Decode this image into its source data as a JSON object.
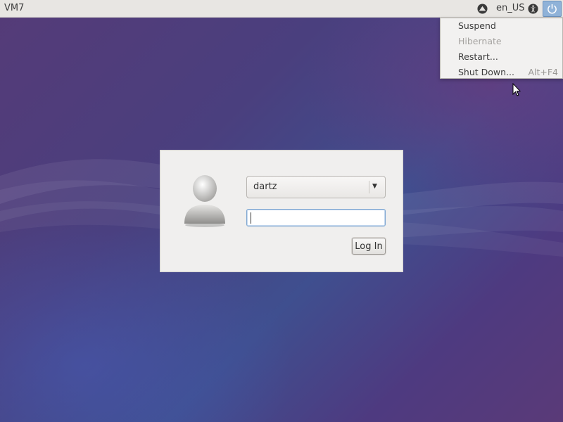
{
  "top_panel": {
    "host_name": "VM7",
    "language": "en_US",
    "icons": {
      "network": "network-icon",
      "accessibility": "accessibility-icon",
      "power": "power-icon"
    }
  },
  "power_menu": {
    "items": [
      {
        "label": "Suspend",
        "enabled": true,
        "accel": ""
      },
      {
        "label": "Hibernate",
        "enabled": false,
        "accel": ""
      },
      {
        "label": "Restart...",
        "enabled": true,
        "accel": ""
      },
      {
        "label": "Shut Down...",
        "enabled": true,
        "accel": "Alt+F4"
      }
    ]
  },
  "login": {
    "selected_user": "dartz",
    "password_value": "",
    "login_label": "Log In",
    "avatar_icon": "user-avatar-icon",
    "dropdown_icon": "chevron-down-icon"
  },
  "colors": {
    "panel": "#e8e6e3",
    "power_button_active": "#8fb2d8",
    "input_focus": "#7ea6d1"
  }
}
